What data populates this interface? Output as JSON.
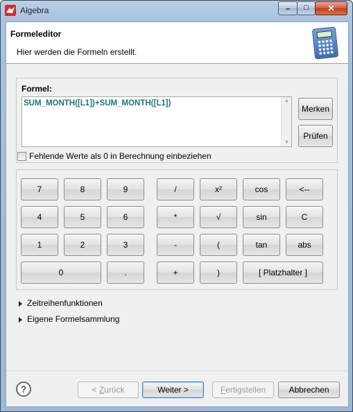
{
  "window": {
    "title": "Algebra",
    "minimize_glyph": "–",
    "maximize_glyph": "□",
    "close_glyph": "✕"
  },
  "header": {
    "title": "Formeleditor",
    "description": "Hier werden die Formeln erstellt.",
    "icon": "calculator-icon"
  },
  "formula": {
    "label": "Formel:",
    "value": "SUM_MONTH([L1])+SUM_MONTH([L1])",
    "merken_label": "Merken",
    "pruefen_label": "Prüfen",
    "checkbox_label": "Fehlende Werte als 0 in Berechnung einbeziehen",
    "checkbox_checked": false
  },
  "keypad": {
    "rows": [
      [
        "7",
        "8",
        "9",
        "/",
        "x²",
        "cos",
        "<--"
      ],
      [
        "4",
        "5",
        "6",
        "*",
        "√",
        "sin",
        "C"
      ],
      [
        "1",
        "2",
        "3",
        "-",
        "(",
        "tan",
        "abs"
      ],
      [
        "0",
        ".",
        "+",
        ")",
        "[ Platzhalter ]"
      ]
    ]
  },
  "sections": [
    {
      "label": "Zeitreihenfunktionen",
      "expanded": false
    },
    {
      "label": "Eigene Formelsammlung",
      "expanded": false
    }
  ],
  "footer": {
    "help_glyph": "?",
    "back_label": "< Zurück",
    "back_mnemonic": "Z",
    "next_label": "Weiter >",
    "finish_label": "Fertigstellen",
    "cancel_label": "Abbrechen"
  },
  "colors": {
    "formula_text": "#1a7a6e",
    "titlebar": "#a8c2de",
    "close_button": "#c23a22"
  }
}
